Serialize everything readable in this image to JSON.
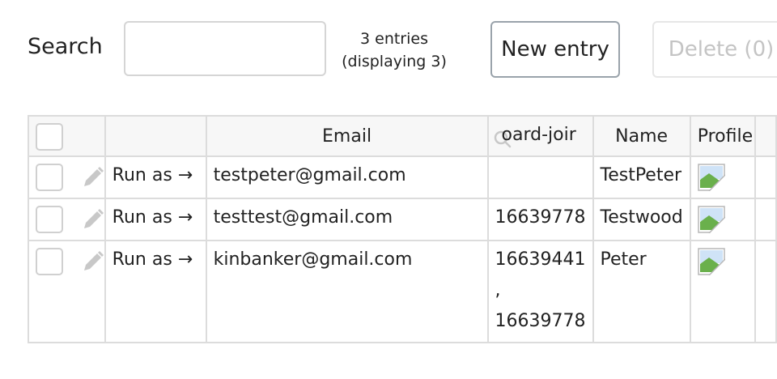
{
  "toolbar": {
    "search_label": "Search",
    "search_value": "",
    "entries_count": "3 entries",
    "entries_displaying": "(displaying 3)",
    "new_entry_label": "New entry",
    "delete_label": "Delete (0)"
  },
  "table": {
    "columns": {
      "select": "",
      "run_as": "",
      "email": "Email",
      "onboard": "oard-joir",
      "name": "Name",
      "profile": "Profile"
    },
    "rows": [
      {
        "run_as": "Run as →",
        "email": "testpeter@gmail.com",
        "onboard_line1": "",
        "onboard_line2": "",
        "onboard_line3": "",
        "name": "TestPeter",
        "profile_icon": "broken-image-icon"
      },
      {
        "run_as": "Run as →",
        "email": "testtest@gmail.com",
        "onboard_line1": "16639778",
        "onboard_line2": "",
        "onboard_line3": "",
        "name": "Testwood",
        "profile_icon": "broken-image-icon"
      },
      {
        "run_as": "Run as →",
        "email": "kinbanker@gmail.com",
        "onboard_line1": "16639441",
        "onboard_line2": ",",
        "onboard_line3": "16639778",
        "name": "Peter",
        "profile_icon": "broken-image-icon"
      }
    ]
  },
  "colors": {
    "border": "#dcdcdc",
    "header_bg": "#f7f7f7",
    "disabled_text": "#c4c4c4",
    "icon_gray": "#c8c8c8"
  }
}
